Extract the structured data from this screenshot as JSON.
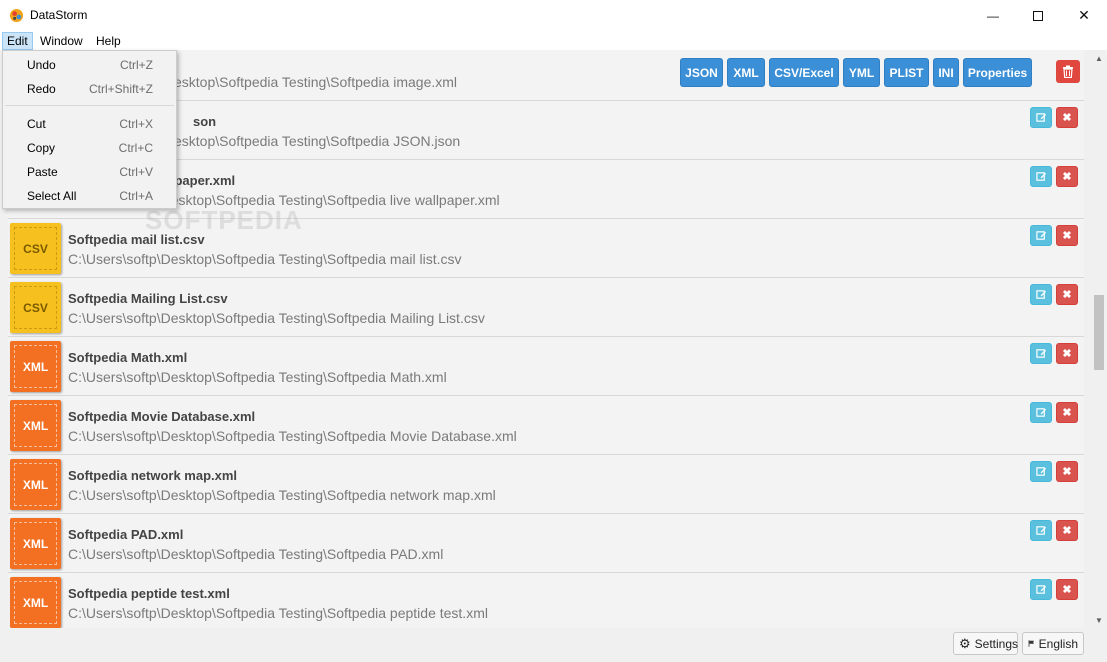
{
  "window": {
    "title": "DataStorm",
    "minimize": "—",
    "close": "✕"
  },
  "menubar": {
    "edit": "Edit",
    "window": "Window",
    "help": "Help"
  },
  "edit_menu": {
    "items": [
      {
        "label": "Undo",
        "shortcut": "Ctrl+Z"
      },
      {
        "label": "Redo",
        "shortcut": "Ctrl+Shift+Z"
      },
      {
        "label": "Cut",
        "shortcut": "Ctrl+X"
      },
      {
        "label": "Copy",
        "shortcut": "Ctrl+C"
      },
      {
        "label": "Paste",
        "shortcut": "Ctrl+V"
      },
      {
        "label": "Select All",
        "shortcut": "Ctrl+A"
      }
    ]
  },
  "toolbar": {
    "formats": [
      "JSON",
      "XML",
      "CSV/Excel",
      "YML",
      "PLIST",
      "INI",
      "Properties"
    ]
  },
  "files": [
    {
      "type": "",
      "name": "",
      "path": "\\Desktop\\Softpedia Testing\\Softpedia image.xml"
    },
    {
      "type": "",
      "name": "son",
      "path": "\\Desktop\\Softpedia Testing\\Softpedia JSON.json"
    },
    {
      "type": "",
      "name": "allpaper.xml",
      "path": "C:\\Users\\softp\\Desktop\\Softpedia Testing\\Softpedia live wallpaper.xml"
    },
    {
      "type": "CSV",
      "name": "Softpedia mail list.csv",
      "path": "C:\\Users\\softp\\Desktop\\Softpedia Testing\\Softpedia mail list.csv"
    },
    {
      "type": "CSV",
      "name": "Softpedia Mailing List.csv",
      "path": "C:\\Users\\softp\\Desktop\\Softpedia Testing\\Softpedia Mailing List.csv"
    },
    {
      "type": "XML",
      "name": "Softpedia Math.xml",
      "path": "C:\\Users\\softp\\Desktop\\Softpedia Testing\\Softpedia Math.xml"
    },
    {
      "type": "XML",
      "name": "Softpedia Movie Database.xml",
      "path": "C:\\Users\\softp\\Desktop\\Softpedia Testing\\Softpedia Movie Database.xml"
    },
    {
      "type": "XML",
      "name": "Softpedia network map.xml",
      "path": "C:\\Users\\softp\\Desktop\\Softpedia Testing\\Softpedia network map.xml"
    },
    {
      "type": "XML",
      "name": "Softpedia PAD.xml",
      "path": "C:\\Users\\softp\\Desktop\\Softpedia Testing\\Softpedia PAD.xml"
    },
    {
      "type": "XML",
      "name": "Softpedia peptide test.xml",
      "path": "C:\\Users\\softp\\Desktop\\Softpedia Testing\\Softpedia peptide test.xml"
    }
  ],
  "footer": {
    "settings": "Settings",
    "language": "English"
  },
  "watermark": "SOFTPEDIA",
  "colors": {
    "accent_blue": "#3a8fd6",
    "danger_red": "#d9534f",
    "info_cyan": "#5bc0de",
    "csv_yellow": "#f6c11e",
    "xml_orange": "#f36f21"
  }
}
